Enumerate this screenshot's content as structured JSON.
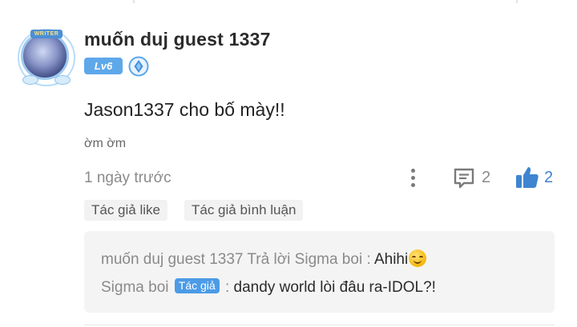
{
  "comment": {
    "avatar": {
      "frame_label": "WRITER",
      "icon": "avatar-writer-frame"
    },
    "username": "muốn duj guest 1337",
    "level_badge": "Lv6",
    "verify_icon": "diamond-badge-icon",
    "text": "Jason1337 cho bố mày!!",
    "subtext": "ờm ờm",
    "timestamp": "1 ngày trước",
    "actions": {
      "more_icon": "more-vertical-icon",
      "comment_icon": "comment-bubble-icon",
      "comment_count": "2",
      "like_icon": "thumbs-up-icon",
      "like_count": "2"
    },
    "tags": [
      "Tác giả like",
      "Tác giả bình luận"
    ]
  },
  "replies": [
    {
      "author": "muốn duj guest 1337",
      "verb": "Trả lời",
      "target": "Sigma boi",
      "separator": ":",
      "text": "Ahihi",
      "emoji": "smiling-emoji"
    },
    {
      "author": "Sigma boi",
      "author_tag": "Tác giả",
      "separator": ":",
      "text": "dandy world lòi đâu ra-IDOL?!"
    }
  ],
  "colors": {
    "accent": "#3f84d1",
    "level_badge": "#5ea8ea",
    "author_tag": "#4c9be6",
    "reply_bg": "#f4f4f4",
    "tag_bg": "#f2f2f2"
  }
}
